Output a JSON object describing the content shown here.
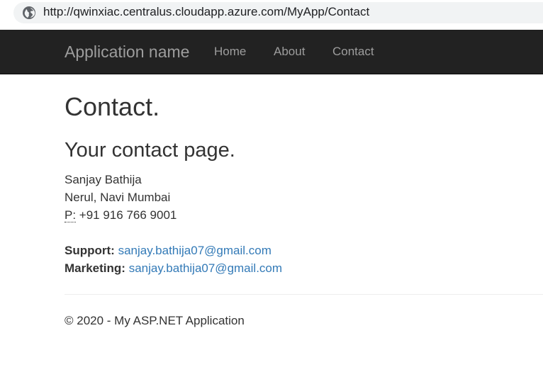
{
  "browser": {
    "url": "http://qwinxiac.centralus.cloudapp.azure.com/MyApp/Contact",
    "site_icon": "globe-icon"
  },
  "navbar": {
    "brand": "Application name",
    "links": [
      "Home",
      "About",
      "Contact"
    ],
    "background": "#222222",
    "link_color": "#9d9d9d"
  },
  "main": {
    "title": "Contact.",
    "subtitle": "Your contact page.",
    "address": {
      "name": "Sanjay Bathija",
      "location": "Nerul, Navi Mumbai",
      "phone_label": "P:",
      "phone": "+91 916 766 9001"
    },
    "support": {
      "label": "Support:",
      "email": "sanjay.bathija07@gmail.com"
    },
    "marketing": {
      "label": "Marketing:",
      "email": "sanjay.bathija07@gmail.com"
    },
    "link_color": "#337ab7"
  },
  "footer": {
    "text": "© 2020 - My ASP.NET Application"
  }
}
